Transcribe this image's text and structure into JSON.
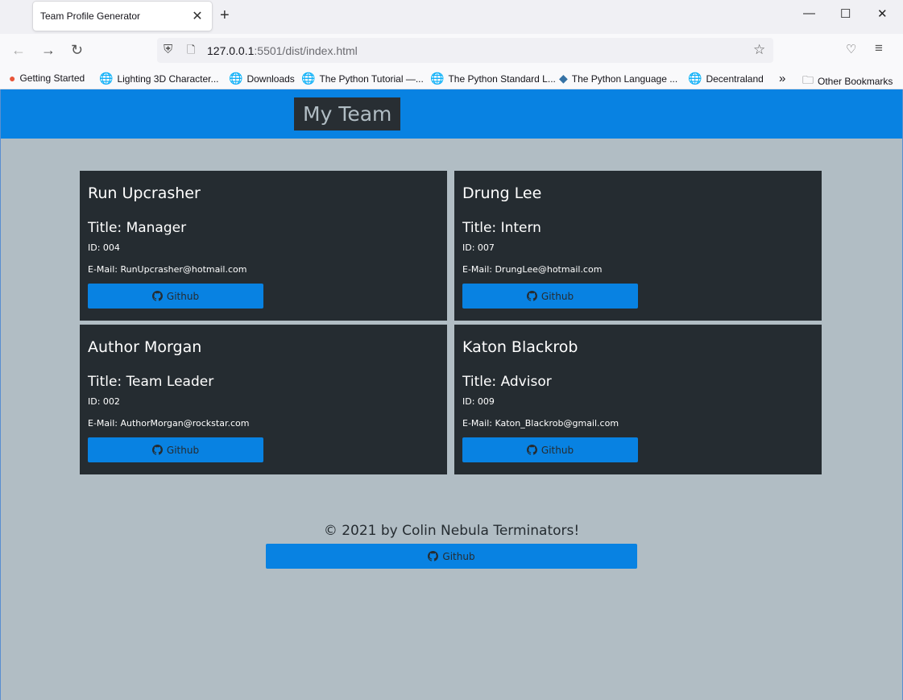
{
  "browser": {
    "tab_title": "Team Profile Generator",
    "tab_close": "✕",
    "new_tab": "+",
    "url_host": "127.0.0.1",
    "url_rest": ":5501/dist/index.html",
    "bookmarks": [
      "Getting Started",
      "Lighting 3D Character...",
      "Downloads",
      "The Python Tutorial —...",
      "The Python Standard L...",
      "The Python Language ...",
      "Decentraland"
    ],
    "overflow": "»",
    "other_bookmarks": "Other Bookmarks"
  },
  "header": {
    "brand": "My Team"
  },
  "cards": [
    {
      "name": "Run Upcrasher",
      "title": "Title: Manager",
      "id": "ID: 004",
      "email": "E-Mail: RunUpcrasher@hotmail.com",
      "button": "Github"
    },
    {
      "name": "Drung Lee",
      "title": "Title: Intern",
      "id": "ID: 007",
      "email": "E-Mail: DrungLee@hotmail.com",
      "button": "Github"
    },
    {
      "name": "Author Morgan",
      "title": "Title: Team Leader",
      "id": "ID: 002",
      "email": "E-Mail: AuthorMorgan@rockstar.com",
      "button": "Github"
    },
    {
      "name": "Katon Blackrob",
      "title": "Title: Advisor",
      "id": "ID: 009",
      "email": "E-Mail: Katon_Blackrob@gmail.com",
      "button": "Github"
    }
  ],
  "footer": {
    "text": "© 2021 by Colin Nebula Terminators!",
    "button": "Github"
  },
  "colors": {
    "accent": "#0882e2",
    "card": "#252c31",
    "page": "#b1bdc4"
  }
}
